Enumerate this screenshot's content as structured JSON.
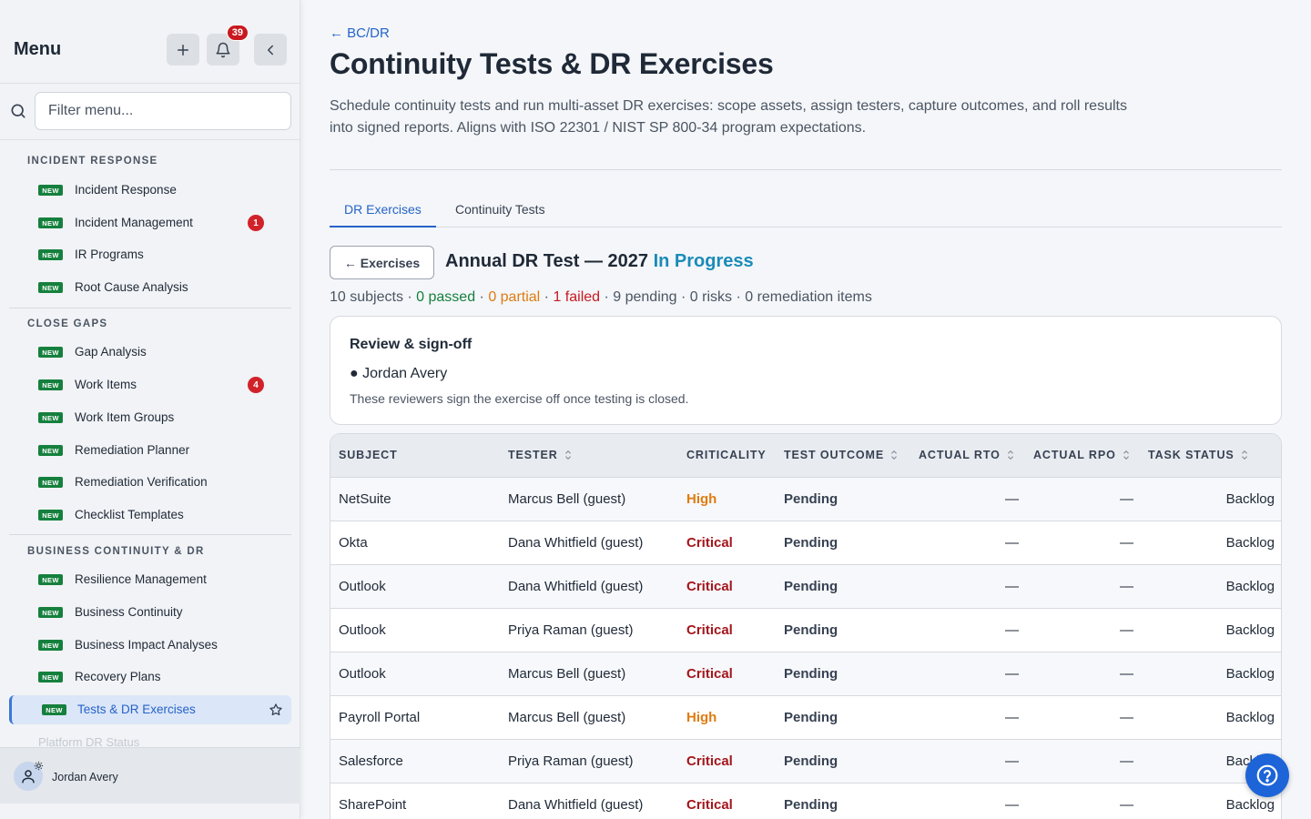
{
  "sidebar": {
    "title": "Menu",
    "notifications_count": "39",
    "filter_placeholder": "Filter menu...",
    "sections": [
      {
        "label": "INCIDENT RESPONSE",
        "items": [
          {
            "badge": "NEW",
            "label": "Incident Response",
            "count": ""
          },
          {
            "badge": "NEW",
            "label": "Incident Management",
            "count": "1"
          },
          {
            "badge": "NEW",
            "label": "IR Programs",
            "count": ""
          },
          {
            "badge": "NEW",
            "label": "Root Cause Analysis",
            "count": ""
          }
        ]
      },
      {
        "label": "CLOSE GAPS",
        "items": [
          {
            "badge": "NEW",
            "label": "Gap Analysis",
            "count": ""
          },
          {
            "badge": "NEW",
            "label": "Work Items",
            "count": "4"
          },
          {
            "badge": "NEW",
            "label": "Work Item Groups",
            "count": ""
          },
          {
            "badge": "NEW",
            "label": "Remediation Planner",
            "count": ""
          },
          {
            "badge": "NEW",
            "label": "Remediation Verification",
            "count": ""
          },
          {
            "badge": "NEW",
            "label": "Checklist Templates",
            "count": ""
          }
        ]
      },
      {
        "label": "BUSINESS CONTINUITY & DR",
        "items": [
          {
            "badge": "NEW",
            "label": "Resilience Management",
            "count": ""
          },
          {
            "badge": "NEW",
            "label": "Business Continuity",
            "count": ""
          },
          {
            "badge": "NEW",
            "label": "Business Impact Analyses",
            "count": ""
          },
          {
            "badge": "NEW",
            "label": "Recovery Plans",
            "count": ""
          },
          {
            "badge": "NEW",
            "label": "Tests & DR Exercises",
            "count": "",
            "active": true
          }
        ]
      }
    ],
    "faded_item": "Platform DR Status",
    "user_name": "Jordan Avery"
  },
  "header": {
    "back_link": "← BC/DR",
    "title": "Continuity Tests & DR Exercises",
    "description": "Schedule continuity tests and run multi-asset DR exercises: scope assets, assign testers, capture outcomes, and roll results into signed reports. Aligns with ISO 22301 / NIST SP 800-34 program expectations."
  },
  "tabs": [
    {
      "label": "DR Exercises",
      "active": true
    },
    {
      "label": "Continuity Tests",
      "active": false
    }
  ],
  "exercise": {
    "back_button": "← Exercises",
    "name": "Annual DR Test — 2027",
    "status": "In Progress",
    "stats": {
      "subjects": "10 subjects",
      "passed": "0 passed",
      "partial": "0 partial",
      "failed": "1 failed",
      "pending": "9 pending",
      "risks": "0 risks",
      "remediation": "0 remediation items",
      "sep": " · "
    }
  },
  "review": {
    "title": "Review & sign-off",
    "reviewer": "● Jordan Avery",
    "note": "These reviewers sign the exercise off once testing is closed."
  },
  "table": {
    "columns": [
      "SUBJECT",
      "TESTER",
      "CRITICALITY",
      "TEST OUTCOME",
      "ACTUAL RTO",
      "ACTUAL RPO",
      "TASK STATUS"
    ],
    "rows": [
      {
        "subject": "NetSuite",
        "tester": "Marcus Bell (guest)",
        "criticality": "High",
        "outcome": "Pending",
        "rto": "—",
        "rpo": "—",
        "task": "Backlog"
      },
      {
        "subject": "Okta",
        "tester": "Dana Whitfield (guest)",
        "criticality": "Critical",
        "outcome": "Pending",
        "rto": "—",
        "rpo": "—",
        "task": "Backlog"
      },
      {
        "subject": "Outlook",
        "tester": "Dana Whitfield (guest)",
        "criticality": "Critical",
        "outcome": "Pending",
        "rto": "—",
        "rpo": "—",
        "task": "Backlog"
      },
      {
        "subject": "Outlook",
        "tester": "Priya Raman (guest)",
        "criticality": "Critical",
        "outcome": "Pending",
        "rto": "—",
        "rpo": "—",
        "task": "Backlog"
      },
      {
        "subject": "Outlook",
        "tester": "Marcus Bell (guest)",
        "criticality": "Critical",
        "outcome": "Pending",
        "rto": "—",
        "rpo": "—",
        "task": "Backlog"
      },
      {
        "subject": "Payroll Portal",
        "tester": "Marcus Bell (guest)",
        "criticality": "High",
        "outcome": "Pending",
        "rto": "—",
        "rpo": "—",
        "task": "Backlog"
      },
      {
        "subject": "Salesforce",
        "tester": "Priya Raman (guest)",
        "criticality": "Critical",
        "outcome": "Pending",
        "rto": "—",
        "rpo": "—",
        "task": "Backlog"
      },
      {
        "subject": "SharePoint",
        "tester": "Dana Whitfield (guest)",
        "criticality": "Critical",
        "outcome": "Pending",
        "rto": "—",
        "rpo": "—",
        "task": "Backlog"
      }
    ]
  },
  "colors": {
    "accent": "#2563c9",
    "status_in_progress": "#1a8bb8",
    "new_badge": "#15803d",
    "count_badge": "#d1222a",
    "crit_high": "#e07b10",
    "crit_critical": "#a3161c"
  },
  "icons": {
    "add": "plus-icon",
    "notifications": "bell-icon",
    "collapse": "chevron-left-icon",
    "filter": "search-icon",
    "favorite": "star-icon",
    "user": "user-icon",
    "settings": "gear-icon",
    "sort": "sort-icon",
    "help": "help-icon"
  }
}
